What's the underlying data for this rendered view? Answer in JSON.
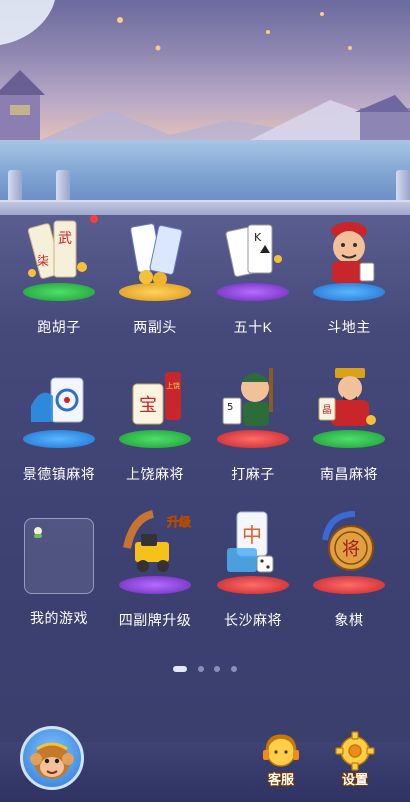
{
  "games": [
    {
      "id": "paohuzi",
      "label": "跑胡子",
      "badge": true
    },
    {
      "id": "liangfutou",
      "label": "两副头"
    },
    {
      "id": "wushik",
      "label": "五十K"
    },
    {
      "id": "doudizhu",
      "label": "斗地主"
    },
    {
      "id": "jingdezhen",
      "label": "景德镇麻将"
    },
    {
      "id": "shangrao",
      "label": "上饶麻将"
    },
    {
      "id": "damazi",
      "label": "打麻子"
    },
    {
      "id": "nanchang",
      "label": "南昌麻将"
    },
    {
      "id": "mygames",
      "label": "我的游戏"
    },
    {
      "id": "sifupai",
      "label": "四副牌升级"
    },
    {
      "id": "changsha",
      "label": "长沙麻将"
    },
    {
      "id": "xiangqi",
      "label": "象棋"
    }
  ],
  "icon_text": {
    "paohuzi_card1": "武",
    "paohuzi_card2": "柒",
    "shangrao_tile": "宝",
    "shangrao_firework": "上饶",
    "nanchang_tile": "晶",
    "sifupai_badge": "升级",
    "changsha_tile": "中",
    "xiangqi_piece": "将",
    "wushik_card": "K",
    "damazi_card": "5"
  },
  "pagination": {
    "total": 4,
    "active": 0
  },
  "bottom": {
    "service_label": "客服",
    "settings_label": "设置"
  },
  "colors": {
    "green_pedestal": "#2fbf4a",
    "yellow_pedestal": "#f2b52a",
    "purple_pedestal": "#8a3fd6",
    "blue_pedestal": "#2f8fe6",
    "red_pedestal": "#e23b3b",
    "badge_red": "#ff3b3b"
  }
}
